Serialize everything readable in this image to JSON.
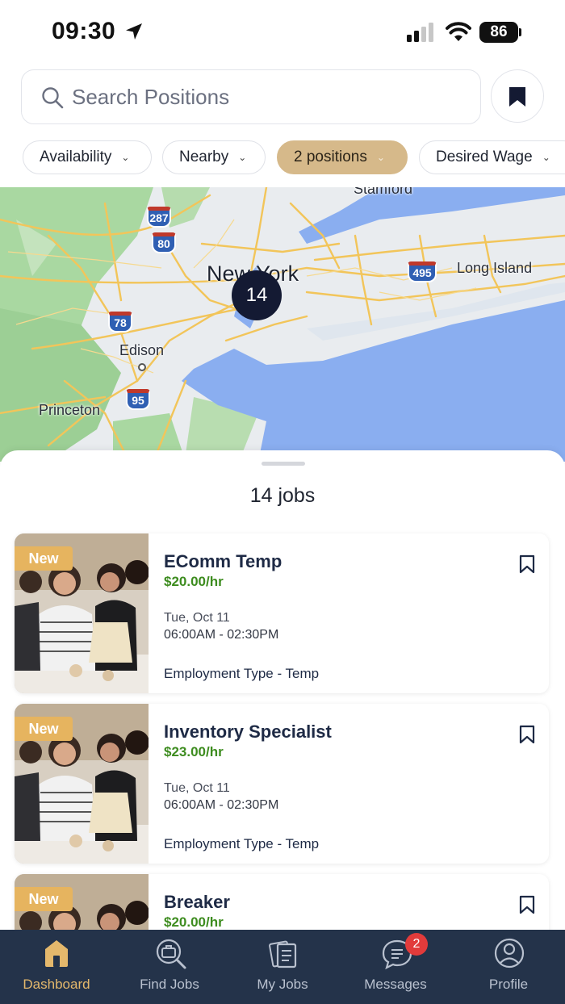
{
  "status_bar": {
    "time": "09:30",
    "battery": "86"
  },
  "search": {
    "placeholder": "Search Positions"
  },
  "filters": [
    {
      "label": "Availability",
      "active": false
    },
    {
      "label": "Nearby",
      "active": false
    },
    {
      "label": "2 positions",
      "active": true
    },
    {
      "label": "Desired Wage",
      "active": false
    }
  ],
  "map": {
    "cluster_count": "14",
    "labels": {
      "stamford": "Stamford",
      "new_york": "New York",
      "long_island": "Long Island",
      "edison": "Edison",
      "princeton": "Princeton"
    },
    "shields": {
      "i287": "287",
      "i80": "80",
      "i78": "78",
      "i495": "495",
      "i95": "95"
    }
  },
  "results": {
    "title": "14 jobs"
  },
  "jobs": [
    {
      "badge": "New",
      "title": "EComm Temp",
      "wage": "$20.00/hr",
      "date": "Tue, Oct 11",
      "time": "06:00AM - 02:30PM",
      "employment_type": "Employment Type - Temp"
    },
    {
      "badge": "New",
      "title": "Inventory Specialist",
      "wage": "$23.00/hr",
      "date": "Tue, Oct 11",
      "time": "06:00AM - 02:30PM",
      "employment_type": "Employment Type - Temp"
    },
    {
      "badge": "New",
      "title": "Breaker",
      "wage": "$20.00/hr"
    }
  ],
  "nav": [
    {
      "label": "Dashboard",
      "icon": "home-icon",
      "active": true
    },
    {
      "label": "Find Jobs",
      "icon": "find-jobs-icon",
      "active": false
    },
    {
      "label": "My Jobs",
      "icon": "my-jobs-icon",
      "active": false
    },
    {
      "label": "Messages",
      "icon": "messages-icon",
      "active": false,
      "badge": "2"
    },
    {
      "label": "Profile",
      "icon": "profile-icon",
      "active": false
    }
  ],
  "colors": {
    "accent": "#d6b98a",
    "nav_background": "#24334a",
    "nav_active": "#e4b86c",
    "wage_green": "#3d8c1f",
    "new_badge": "#e6b45f",
    "cluster": "#141a33",
    "notification_badge": "#e23b3b"
  }
}
